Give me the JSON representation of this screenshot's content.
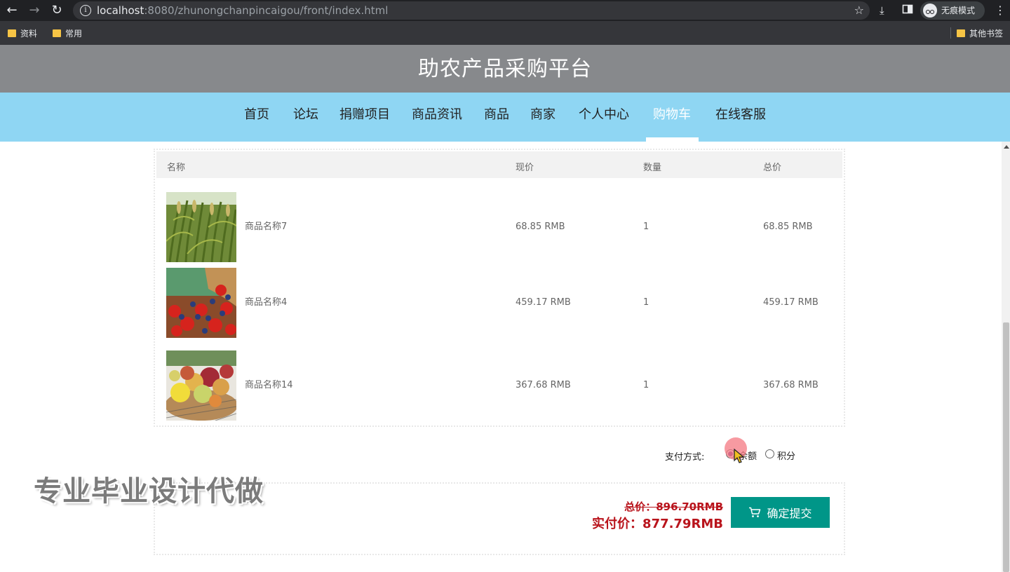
{
  "browser": {
    "url_host": "localhost",
    "url_rest": ":8080/zhunongchanpincaigou/front/index.html",
    "incognito_label": "无痕模式",
    "bookmarks": [
      "资料",
      "常用"
    ],
    "other_bookmarks": "其他书签"
  },
  "site": {
    "title": "助农产品采购平台",
    "nav": [
      "首页",
      "论坛",
      "捐赠项目",
      "商品资讯",
      "商品",
      "商家",
      "个人中心",
      "购物车",
      "在线客服"
    ],
    "active_nav": "购物车"
  },
  "cart": {
    "headers": [
      "名称",
      "现价",
      "数量",
      "总价"
    ],
    "rows": [
      {
        "name": "商品名称7",
        "price": "68.85 RMB",
        "qty": "1",
        "total": "68.85 RMB",
        "image": "millet-field-photo"
      },
      {
        "name": "商品名称4",
        "price": "459.17 RMB",
        "qty": "1",
        "total": "459.17 RMB",
        "image": "strawberry-blueberry-photo"
      },
      {
        "name": "商品名称14",
        "price": "367.68 RMB",
        "qty": "1",
        "total": "367.68 RMB",
        "image": "fruit-basket-photo"
      }
    ]
  },
  "payment": {
    "label": "支付方式:",
    "options": [
      "余额",
      "积分"
    ],
    "selected": "余额"
  },
  "summary": {
    "total_label": "总价：896.70RMB",
    "real_label": "实付价：877.79RMB",
    "submit_label": "确定提交"
  },
  "watermark": "专业毕业设计代做",
  "colors": {
    "title_bar": "#87898c",
    "nav_bar": "#8fd6f3",
    "price_red": "#b9141c",
    "submit_green": "#009688"
  }
}
